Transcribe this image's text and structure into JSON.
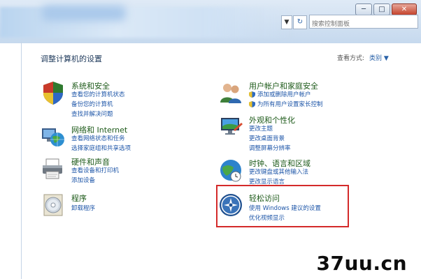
{
  "search": {
    "placeholder": "搜索控制面板"
  },
  "window_controls": {
    "minimize": "─",
    "maximize": "□",
    "close": "✕"
  },
  "nav": {
    "dropdown": "▼",
    "refresh": "↻"
  },
  "page_title": "调整计算机的设置",
  "view_by": {
    "label": "查看方式:",
    "value": "类别 ▼"
  },
  "categories": [
    {
      "title": "系统和安全",
      "icon": "shield-security-icon",
      "links": [
        "查看您的计算机状态",
        "备份您的计算机",
        "查找并解决问题"
      ]
    },
    {
      "title": "网络和 Internet",
      "icon": "network-globe-icon",
      "links": [
        "查看网络状态和任务",
        "选择家庭组和共享选项"
      ]
    },
    {
      "title": "硬件和声音",
      "icon": "printer-icon",
      "links": [
        "查看设备和打印机",
        "添加设备"
      ]
    },
    {
      "title": "程序",
      "icon": "programs-disc-icon",
      "links": [
        "卸载程序"
      ]
    },
    {
      "title": "用户帐户和家庭安全",
      "icon": "users-icon",
      "links": [
        "添加或删除用户帐户",
        "为所有用户设置家长控制"
      ]
    },
    {
      "title": "外观和个性化",
      "icon": "monitor-appearance-icon",
      "links": [
        "更改主题",
        "更改桌面背景",
        "调整屏幕分辨率"
      ]
    },
    {
      "title": "时钟、语言和区域",
      "icon": "clock-globe-icon",
      "links": [
        "更改键盘或其他输入法",
        "更改显示语言"
      ]
    },
    {
      "title": "轻松访问",
      "icon": "ease-of-access-icon",
      "links": [
        "使用 Windows 建议的设置",
        "优化视频显示"
      ]
    }
  ],
  "watermark": "37uu.cn"
}
